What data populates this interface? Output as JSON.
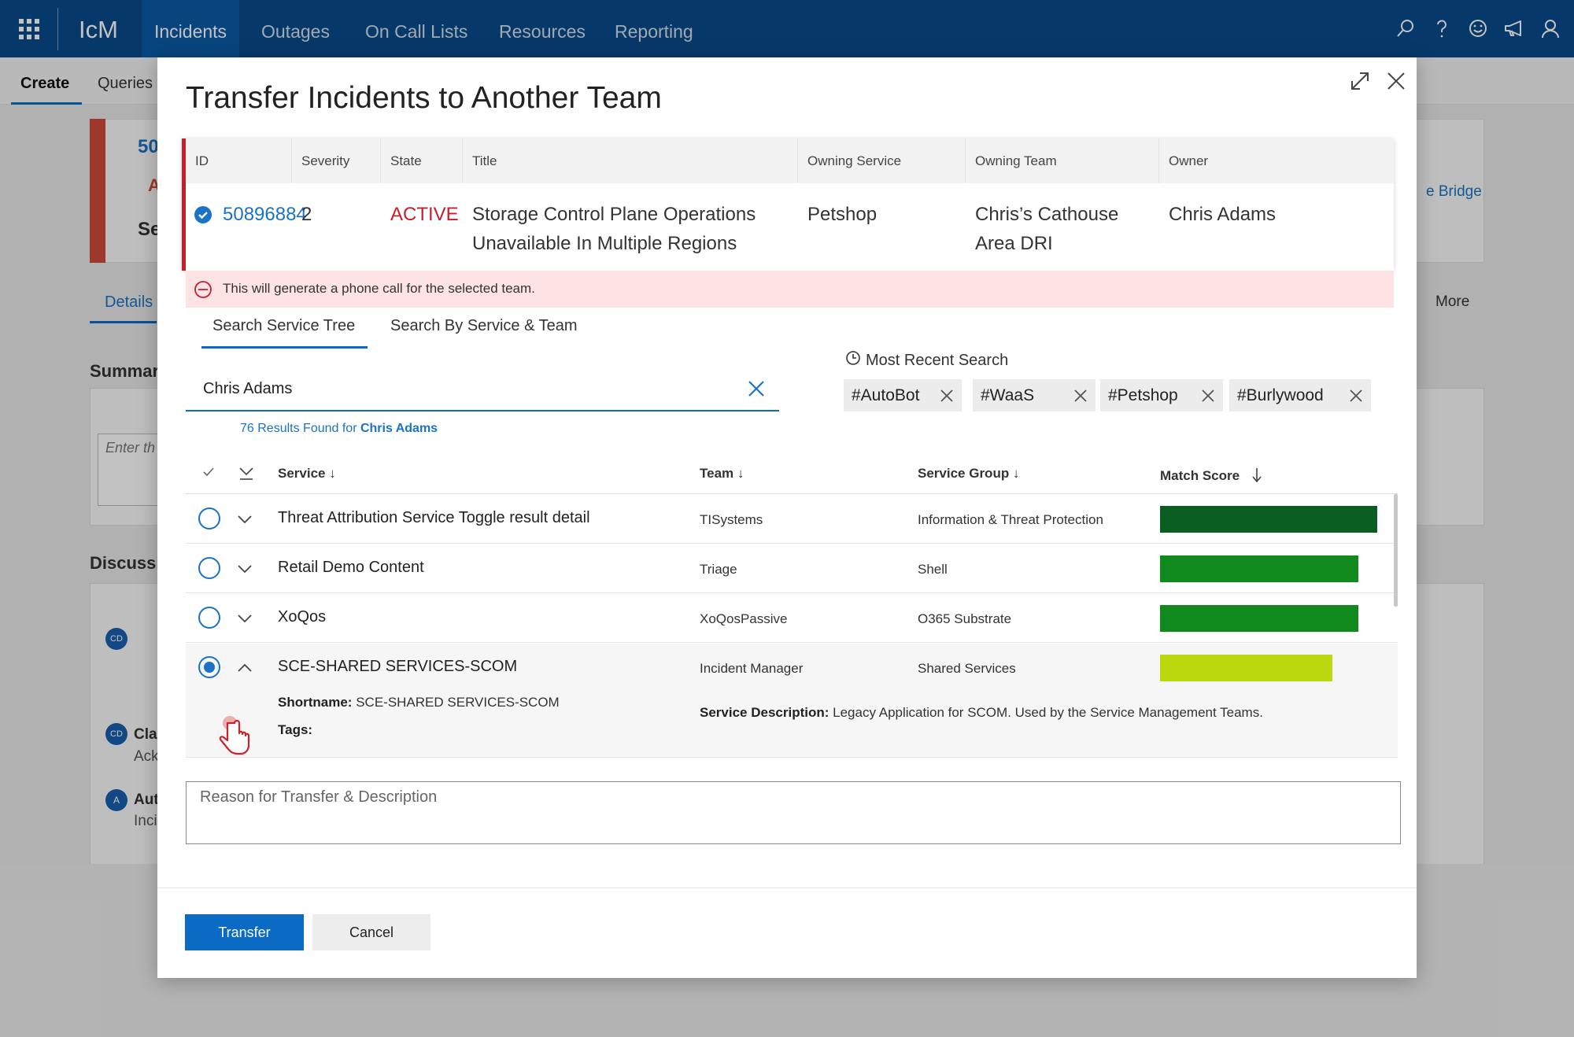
{
  "app": {
    "brand": "IcM",
    "nav": [
      "Incidents",
      "Outages",
      "On Call Lists",
      "Resources",
      "Reporting"
    ],
    "active_nav": "Incidents"
  },
  "background": {
    "subnav": [
      "Create",
      "Queries"
    ],
    "id_prefix": "50",
    "status_letter": "A",
    "severity_prefix": "Se",
    "details_tab": "Details",
    "more_label": "More",
    "bridge_label": "e Bridge",
    "summary_label": "Summar",
    "enter_placeholder": "Enter th",
    "discussion_label": "Discussi",
    "discussion_items": [
      {
        "avatar": "CD"
      },
      {
        "avatar": "CD",
        "name": "Cla",
        "sub": "Ack"
      },
      {
        "avatar": "A",
        "name": "Aut",
        "sub": "Inci"
      }
    ]
  },
  "modal": {
    "title": "Transfer Incidents to Another Team",
    "incident_table": {
      "headers": [
        "ID",
        "Severity",
        "State",
        "Title",
        "Owning Service",
        "Owning Team",
        "Owner"
      ],
      "row": {
        "id": "50896884",
        "severity": "2",
        "state": "ACTIVE",
        "title_line1": "Storage Control Plane  Operations",
        "title_line2": "Unavailable In Multiple Regions",
        "owning_service": "Petshop",
        "owning_team_line1": "Chris’s Cathouse",
        "owning_team_line2": "Area DRI",
        "owner": "Chris Adams"
      }
    },
    "warning": "This will generate a phone call for the selected team.",
    "tabs": [
      "Search Service Tree",
      "Search By Service & Team"
    ],
    "search": {
      "value": "Chris Adams",
      "results_prefix": "76 Results Found for ",
      "results_term": "Chris Adams"
    },
    "recent": {
      "label": "Most Recent Search",
      "chips": [
        "#AutoBot",
        "#WaaS",
        "#Petshop",
        "#Burlywood"
      ]
    },
    "results_table": {
      "headers": {
        "service": "Service ↓",
        "team": "Team ↓",
        "service_group": "Service Group ↓",
        "match_score": "Match Score"
      },
      "rows": [
        {
          "service": "Threat Attribution Service Toggle result detail",
          "team": "TISystems",
          "group": "Information & Threat Protection",
          "score": 0.92,
          "color": "#0b5e22"
        },
        {
          "service": "Retail Demo Content",
          "team": "Triage",
          "group": "Shell",
          "score": 0.84,
          "color": "#108a1c"
        },
        {
          "service": "XoQos",
          "team": "XoQosPassive",
          "group": "O365 Substrate",
          "score": 0.84,
          "color": "#108a1c"
        },
        {
          "service": "SCE-SHARED SERVICES-SCOM",
          "team": "Incident Manager",
          "group": "Shared Services",
          "score": 0.73,
          "color": "#bcd80e"
        }
      ],
      "expanded": {
        "shortname_label": "Shortname:",
        "shortname": "SCE-SHARED SERVICES-SCOM",
        "tags_label": "Tags:",
        "description_label": "Service Description:",
        "description": "Legacy Application for SCOM. Used by the Service Management Teams."
      }
    },
    "reason_placeholder": "Reason for Transfer & Description",
    "buttons": {
      "transfer": "Transfer",
      "cancel": "Cancel"
    }
  }
}
